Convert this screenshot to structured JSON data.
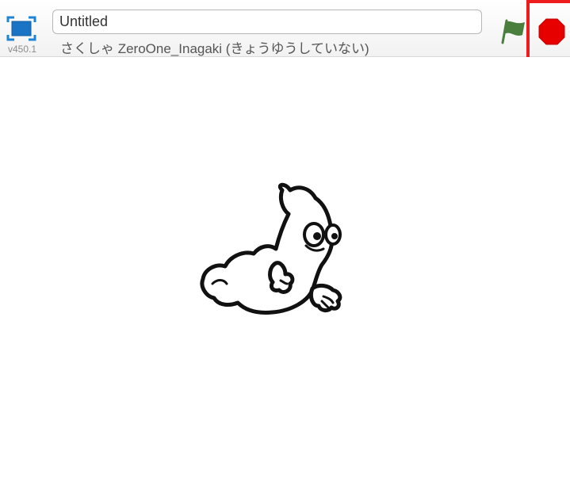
{
  "header": {
    "version": "v450.1",
    "project_title": "Untitled",
    "author_line": "さくしゃ ZeroOne_Inagaki (きょうゆうしていない)"
  },
  "controls": {
    "fullscreen_icon": "fullscreen-icon",
    "green_flag_icon": "green-flag-icon",
    "stop_icon": "stop-sign-icon",
    "highlight_color": "#ee1c1c",
    "stop_color": "#e60000",
    "flag_color": "#4a7f3d"
  },
  "stage": {
    "sprite_icon": "ghost-sprite"
  }
}
